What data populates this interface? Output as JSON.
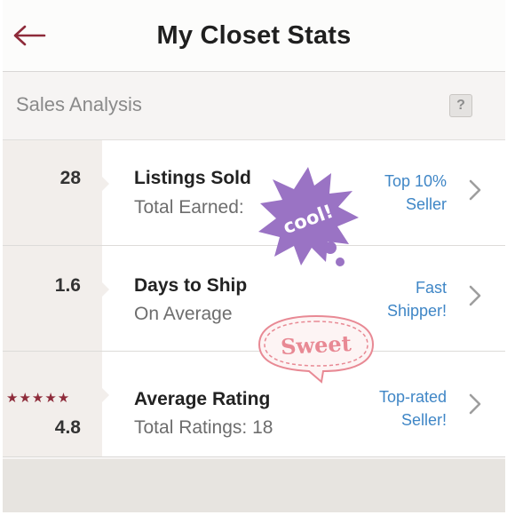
{
  "header": {
    "title": "My Closet Stats",
    "back_icon": "back-arrow-icon"
  },
  "section": {
    "title": "Sales Analysis",
    "help_label": "?"
  },
  "rows": [
    {
      "value": "28",
      "label": "Listings Sold",
      "sublabel": "Total Earned:",
      "badge_line1": "Top 10%",
      "badge_line2": "Seller"
    },
    {
      "value": "1.6",
      "label": "Days to Ship",
      "sublabel": "On Average",
      "badge_line1": "Fast",
      "badge_line2": "Shipper!"
    },
    {
      "value": "4.8",
      "label": "Average Rating",
      "sublabel": "Total Ratings: 18",
      "badge_line1": "Top-rated",
      "badge_line2": "Seller!",
      "stars": "★★★★★",
      "rating_out_of_5": 5
    }
  ],
  "stickers": {
    "cool": "cool!",
    "sweet": "Sweet"
  },
  "colors": {
    "accent_maroon": "#8e2b3a",
    "link_blue": "#3f86c6",
    "sticker_purple": "#9a73c4",
    "sticker_pink": "#e88994"
  }
}
